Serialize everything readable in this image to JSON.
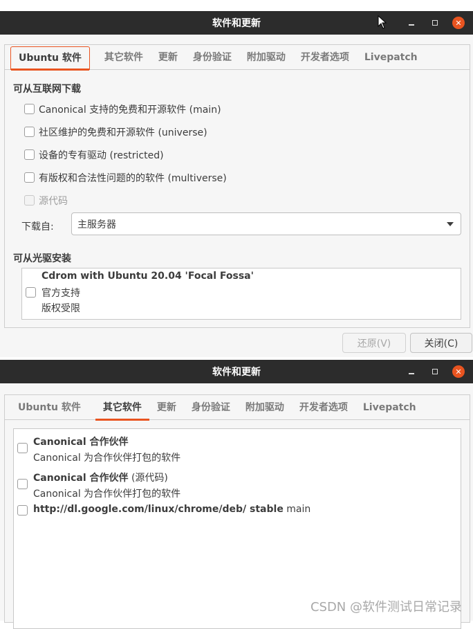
{
  "window1": {
    "title": "软件和更新",
    "tabs": [
      "Ubuntu 软件",
      "其它软件",
      "更新",
      "身份验证",
      "附加驱动",
      "开发者选项",
      "Livepatch"
    ],
    "section_internet": "可从互联网下载",
    "sources": [
      {
        "label": "Canonical 支持的免费和开源软件 (main)",
        "checked": false
      },
      {
        "label": "社区维护的免费和开源软件 (universe)",
        "checked": false
      },
      {
        "label": "设备的专有驱动 (restricted)",
        "checked": false
      },
      {
        "label": "有版权和合法性问题的的软件 (multiverse)",
        "checked": false
      },
      {
        "label": "源代码",
        "checked": false,
        "disabled": true
      }
    ],
    "download_from_label": "下载自:",
    "download_from_value": "主服务器",
    "section_cdrom": "可从光驱安装",
    "cdrom": {
      "title": "Cdrom with Ubuntu 20.04 'Focal Fossa'",
      "line2": "官方支持",
      "line3": "版权受限"
    },
    "revert_button": "还原(V)",
    "close_button": "关闭(C)"
  },
  "window2": {
    "title": "软件和更新",
    "tabs": [
      "Ubuntu 软件",
      "其它软件",
      "更新",
      "身份验证",
      "附加驱动",
      "开发者选项",
      "Livepatch"
    ],
    "entries": [
      {
        "title_bold": "Canonical 合作伙伴",
        "title_rest": "",
        "subtitle": "Canonical 为合作伙伴打包的软件"
      },
      {
        "title_bold": "Canonical 合作伙伴",
        "title_rest": " (源代码)",
        "subtitle": "Canonical 为合作伙伴打包的软件"
      },
      {
        "title_bold": "http://dl.google.com/linux/chrome/deb/ stable",
        "title_rest": " main",
        "subtitle": ""
      }
    ]
  },
  "watermark": "CSDN @软件测试日常记录",
  "colors": {
    "accent": "#e95420",
    "titlebar": "#2c2c2c"
  }
}
